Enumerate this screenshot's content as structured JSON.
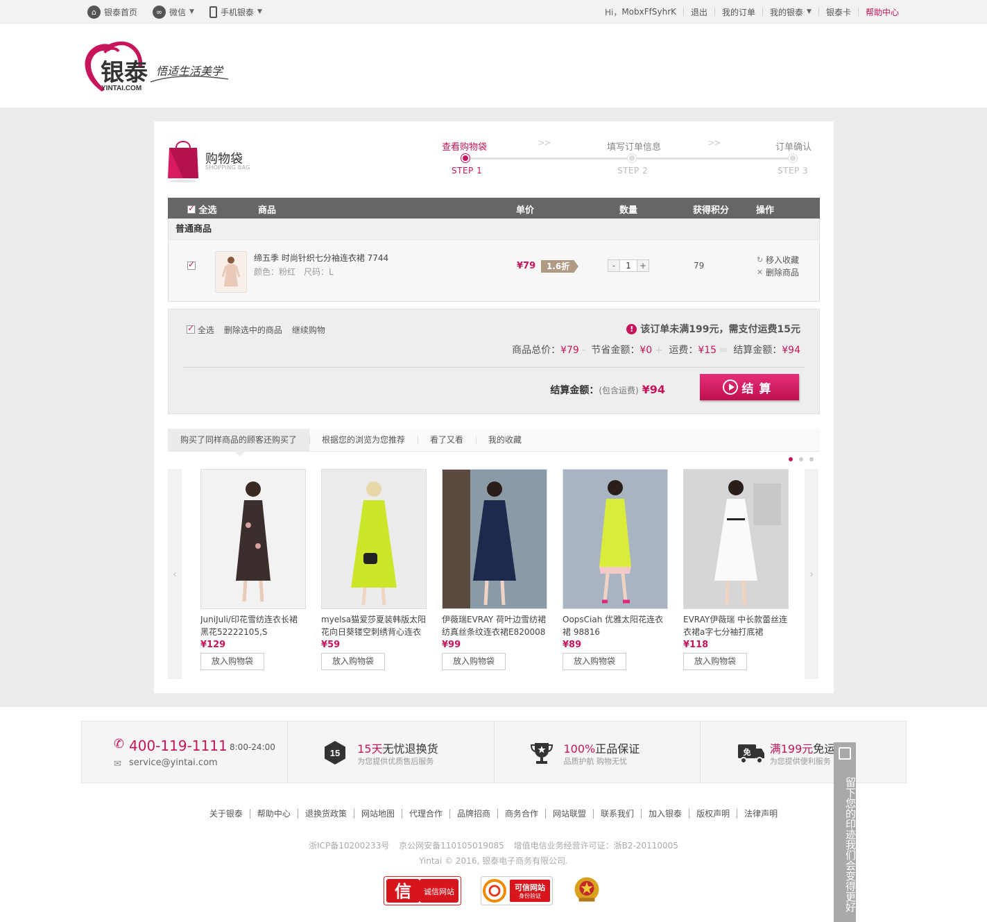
{
  "topbar": {
    "home": "银泰首页",
    "wechat": "微信",
    "mobile": "手机银泰",
    "greeting": "Hi，",
    "username": "MobxFfSyhrK",
    "logout": "退出",
    "orders": "我的订单",
    "my_yintai": "我的银泰",
    "card": "银泰卡",
    "help": "帮助中心"
  },
  "logo": {
    "brand": "银泰",
    "domain": "YINTAI.COM",
    "slogan": "悟适生活美学"
  },
  "cart": {
    "title": "购物袋",
    "subtitle": "SHOPPING BAG",
    "steps": [
      {
        "label": "查看购物袋",
        "no": "STEP 1"
      },
      {
        "label": "填写订单信息",
        "no": "STEP 2"
      },
      {
        "label": "订单确认",
        "no": "STEP 3"
      }
    ],
    "columns": {
      "select_all": "全选",
      "product": "商品",
      "price": "单价",
      "qty": "数量",
      "points": "获得积分",
      "ops": "操作"
    },
    "group_title": "普通商品",
    "item": {
      "name": "缔五季 时尚针织七分袖连衣裙 7744",
      "attrs": "颜色：粉红　尺码：L",
      "price": "¥79",
      "discount": "1.6折",
      "qty": "1",
      "points": "79",
      "fav": "移入收藏",
      "del": "删除商品"
    },
    "summary": {
      "select_all": "全选",
      "delete_selected": "删除选中的商品",
      "continue": "继续购物",
      "warning": "该订单未满199元，需支付运费15元",
      "total_label": "商品总价：",
      "total": "¥79",
      "save_label": "节省金额：",
      "save": "¥0",
      "ship_label": "运费：",
      "ship": "¥15",
      "settle_label": "结算金额：",
      "settle": "¥94",
      "final_label": "结算金额：",
      "final_note": "(包含运费)",
      "final": "¥94",
      "checkout": "结算"
    }
  },
  "reco": {
    "tabs": [
      "购买了同样商品的顾客还购买了",
      "根据您的浏览为您推荐",
      "看了又看",
      "我的收藏"
    ],
    "add_label": "放入购物袋",
    "products": [
      {
        "name": "JuniJuli/印花雪纺连衣长裙 黑花52222105,S",
        "price": "¥129"
      },
      {
        "name": "myelsa猫爱莎夏装韩版太阳花向日葵镂空刺绣背心连衣",
        "price": "¥59"
      },
      {
        "name": "伊薇瑞EVRAY 荷叶边雪纺裙 纺真丝条纹连衣裙E820008",
        "price": "¥99"
      },
      {
        "name": "OopsCiah 优雅太阳花连衣裙 98816",
        "price": "¥89"
      },
      {
        "name": "EVRAY伊薇瑞 中长款蕾丝连衣裙a字七分袖打底裙",
        "price": "¥118"
      }
    ]
  },
  "footer": {
    "phone": "400-119-1111",
    "hours": "8:00-24:00",
    "email": "service@yintai.com",
    "services": [
      {
        "icon": "15",
        "hl": "15天",
        "title": "无忧退换货",
        "sub": "为您提供优质售后服务"
      },
      {
        "hl": "100%",
        "title": "正品保证",
        "sub": "品质护航 购物无忧"
      },
      {
        "icon": "免",
        "hl": "满199元",
        "title": "免运费",
        "sub": "为您提供便利服务"
      }
    ],
    "links": [
      "关于银泰",
      "帮助中心",
      "退换货政策",
      "网站地图",
      "代理合作",
      "品牌招商",
      "商务合作",
      "网站联盟",
      "联系我们",
      "加入银泰",
      "版权声明",
      "法律声明"
    ],
    "icp": "浙ICP备10200233号",
    "police": "京公网安备110105019085",
    "license": "增值电信业务经营许可证：浙B2-20110005",
    "copyright": "Yintai © 2016, 银泰电子商务有限公司.",
    "badge1_icon": "信",
    "badge1": "诚信网站",
    "badge2": "可信网站",
    "badge2_sub": "身份验证"
  },
  "feedback": "留下您的印迹我们会变得更好"
}
